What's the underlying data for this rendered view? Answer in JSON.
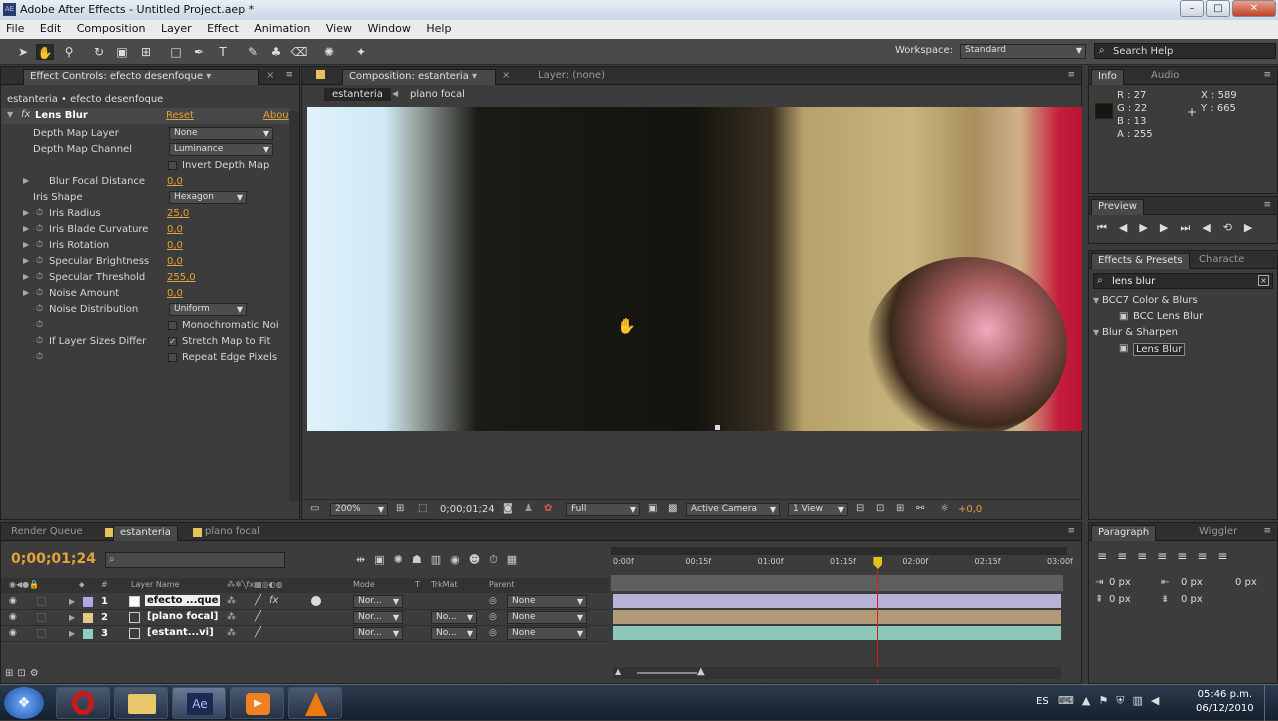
{
  "titlebar": {
    "title": "Adobe After Effects - Untitled Project.aep *",
    "app_icon": "AE",
    "min_icon": "minimize-icon",
    "max_icon": "maximize-icon",
    "close_icon": "close-icon"
  },
  "menu": [
    "File",
    "Edit",
    "Composition",
    "Layer",
    "Effect",
    "Animation",
    "View",
    "Window",
    "Help"
  ],
  "toolbar": {
    "workspace_label": "Workspace:",
    "workspace_value": "Standard",
    "search_placeholder": "Search Help"
  },
  "effect_controls": {
    "tab": "Effect Controls: efecto desenfoque",
    "breadcrumb": "estanteria • efecto desenfoque",
    "effect_name": "Lens Blur",
    "fx": "fx",
    "reset": "Reset",
    "about": "Abou",
    "props": [
      {
        "label": "Depth Map Layer",
        "dropdown": "None"
      },
      {
        "label": "Depth Map Channel",
        "dropdown": "Luminance"
      },
      {
        "label": "",
        "checkbox": "Invert Depth Map",
        "checked": false
      },
      {
        "label": "Blur Focal Distance",
        "value": "0,0",
        "twirl": true,
        "stopwatch": false
      },
      {
        "label": "Iris Shape",
        "dropdown": "Hexagon"
      },
      {
        "label": "Iris Radius",
        "value": "25,0",
        "twirl": true,
        "stopwatch": true
      },
      {
        "label": "Iris Blade Curvature",
        "value": "0,0",
        "twirl": true,
        "stopwatch": true
      },
      {
        "label": "Iris Rotation",
        "value": "0,0",
        "twirl": true,
        "stopwatch": true
      },
      {
        "label": "Specular Brightness",
        "value": "0,0",
        "twirl": true,
        "stopwatch": true
      },
      {
        "label": "Specular Threshold",
        "value": "255,0",
        "twirl": true,
        "stopwatch": true
      },
      {
        "label": "Noise Amount",
        "value": "0,0",
        "twirl": true,
        "stopwatch": true
      },
      {
        "label": "Noise Distribution",
        "dropdown": "Uniform",
        "stopwatch": true
      },
      {
        "label": "",
        "checkbox": "Monochromatic Noi",
        "checked": false,
        "stopwatch": true
      },
      {
        "label": "If Layer Sizes Differ",
        "checkbox": "Stretch Map to Fit",
        "checked": true,
        "stopwatch": true
      },
      {
        "label": "",
        "checkbox": "Repeat Edge Pixels",
        "checked": false,
        "stopwatch": true
      }
    ]
  },
  "composition": {
    "tab": "Composition: estanteria",
    "layer_tab": "Layer: (none)",
    "crumbs": [
      "estanteria",
      "plano focal"
    ],
    "zoom": "200%",
    "timecode": "0;00;01;24",
    "resolution": "Full",
    "camera": "Active Camera",
    "view": "1 View",
    "exposure": "+0,0"
  },
  "info": {
    "tab": "Info",
    "audio_tab": "Audio",
    "r": "R : 27",
    "g": "G : 22",
    "b": "B : 13",
    "a": "A : 255",
    "x": "X : 589",
    "y": "Y : 665",
    "swatch": "#1b160d"
  },
  "preview": {
    "tab": "Preview"
  },
  "effects_presets": {
    "tab": "Effects & Presets",
    "char_tab": "Characte",
    "search": "lens blur",
    "tree": [
      {
        "label": "BCC7 Color & Blurs",
        "indent": 0
      },
      {
        "label": "BCC Lens Blur",
        "indent": 1
      },
      {
        "label": "Blur & Sharpen",
        "indent": 0
      },
      {
        "label": "Lens Blur",
        "indent": 1,
        "selected": true
      }
    ]
  },
  "timeline": {
    "tabs": [
      "Render Queue",
      "estanteria",
      "plano focal"
    ],
    "timecode": "0;00;01;24",
    "col_headers": {
      "num": "#",
      "name": "Layer Name",
      "mode": "Mode",
      "t": "T",
      "trkmat": "TrkMat",
      "parent": "Parent"
    },
    "ruler": [
      "0:00f",
      "00:15f",
      "01:00f",
      "01:15f",
      "02:00f",
      "02:15f",
      "03:00f"
    ],
    "playhead": 1.8,
    "duration": 3.0,
    "layers": [
      {
        "num": "1",
        "name": "efecto ...que",
        "mode": "Nor...",
        "trkmat": "",
        "parent": "None",
        "color": "#b3a8e6",
        "bar": "#b7b2d8"
      },
      {
        "num": "2",
        "name": "[plano focal]",
        "mode": "Nor...",
        "trkmat": "No...",
        "parent": "None",
        "color": "#e4c88a",
        "bar": "#b09a78"
      },
      {
        "num": "3",
        "name": "[estant...vi]",
        "mode": "Nor...",
        "trkmat": "No...",
        "parent": "None",
        "color": "#8ad0c4",
        "bar": "#8ec8b8"
      }
    ]
  },
  "paragraph": {
    "tab": "Paragraph",
    "wiggler_tab": "Wiggler",
    "fields": [
      "0 px",
      "0 px",
      "0 px",
      "0 px",
      "0 px"
    ]
  },
  "taskbar": {
    "lang": "ES",
    "time": "05:46 p.m.",
    "date": "06/12/2010"
  }
}
